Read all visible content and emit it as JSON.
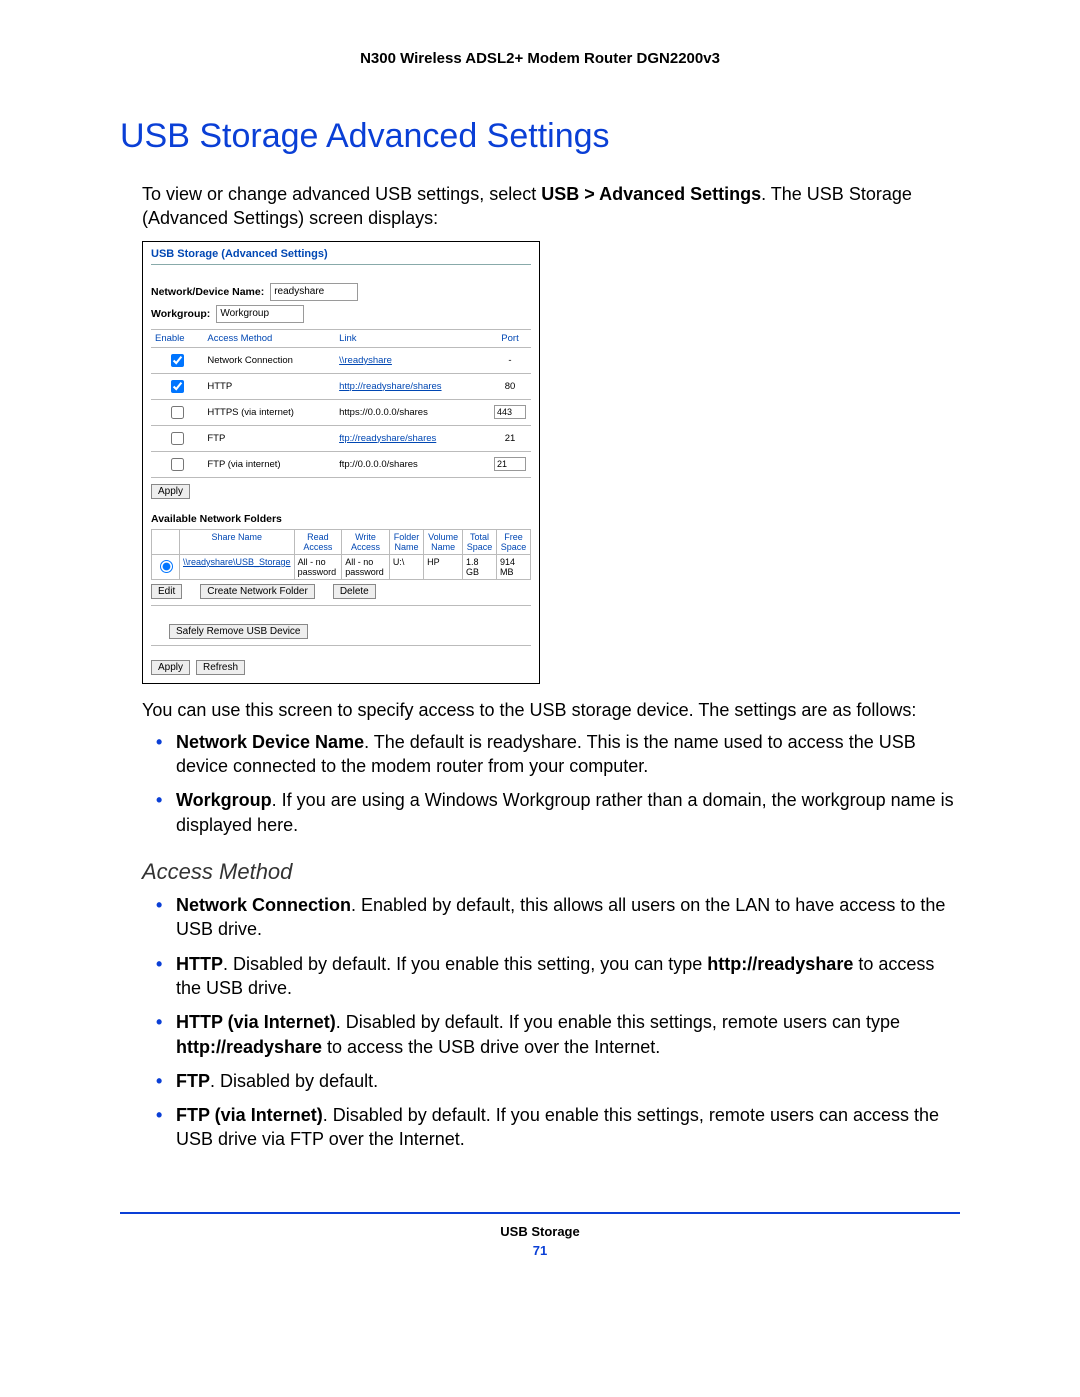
{
  "header": "N300 Wireless ADSL2+ Modem Router DGN2200v3",
  "section_title": "USB Storage Advanced Settings",
  "intro_pre": "To view or change advanced USB settings, select ",
  "intro_bold": "USB > Advanced Settings",
  "intro_post": ". The USB Storage (Advanced Settings) screen displays:",
  "panel": {
    "title": "USB Storage (Advanced Settings)",
    "device_label": "Network/Device Name:",
    "device_value": "readyshare",
    "workgroup_label": "Workgroup:",
    "workgroup_value": "Workgroup",
    "access": {
      "headers": {
        "enable": "Enable",
        "method": "Access Method",
        "link": "Link",
        "port": "Port"
      },
      "rows": [
        {
          "checked": true,
          "method": "Network Connection",
          "link": "\\\\readyshare",
          "is_link": true,
          "port": "-",
          "port_editable": false
        },
        {
          "checked": true,
          "method": "HTTP",
          "link": "http://readyshare/shares",
          "is_link": true,
          "port": "80",
          "port_editable": false
        },
        {
          "checked": false,
          "method": "HTTPS (via internet)",
          "link": "https://0.0.0.0/shares",
          "is_link": false,
          "port": "443",
          "port_editable": true
        },
        {
          "checked": false,
          "method": "FTP",
          "link": "ftp://readyshare/shares",
          "is_link": true,
          "port": "21",
          "port_editable": false
        },
        {
          "checked": false,
          "method": "FTP (via internet)",
          "link": "ftp://0.0.0.0/shares",
          "is_link": false,
          "port": "21",
          "port_editable": true
        }
      ]
    },
    "apply": "Apply",
    "folders_title": "Available Network Folders",
    "folders": {
      "headers": {
        "share": "Share Name",
        "read": "Read Access",
        "write": "Write Access",
        "folder": "Folder Name",
        "volume": "Volume Name",
        "total": "Total Space",
        "free": "Free Space"
      },
      "rows": [
        {
          "selected": true,
          "share": "\\\\readyshare\\USB_Storage",
          "read": "All - no password",
          "write": "All - no password",
          "folder": "U:\\",
          "volume": "HP",
          "total": "1.8 GB",
          "free": "914 MB"
        }
      ]
    },
    "buttons": {
      "edit": "Edit",
      "create": "Create Network Folder",
      "delete": "Delete",
      "safe": "Safely Remove USB Device",
      "apply2": "Apply",
      "refresh": "Refresh"
    }
  },
  "after_panel": "You can use this screen to specify access to the USB storage device. The settings are as follows:",
  "main_bullets": [
    {
      "bold": "Network Device Name",
      "text": ". The default is readyshare. This is the name used to access the USB device connected to the modem router from your computer."
    },
    {
      "bold": "Workgroup",
      "text": ". If you are using a Windows Workgroup rather than a domain, the workgroup name is displayed here."
    }
  ],
  "access_heading": "Access Method",
  "access_bullets": [
    {
      "bold": "Network Connection",
      "text_pre": ". Enabled by default, this allows all users on the LAN to have access to the USB drive."
    },
    {
      "bold": "HTTP",
      "text_pre": ". Disabled by default. If you enable this setting, you can type ",
      "bold2": "http://readyshare",
      "text_post": " to access the USB drive."
    },
    {
      "bold": "HTTP (via Internet)",
      "text_pre": ". Disabled by default. If you enable this settings, remote users can type ",
      "bold2": "http://readyshare",
      "text_post": " to access the USB drive over the Internet."
    },
    {
      "bold": "FTP",
      "text_pre": ". Disabled by default."
    },
    {
      "bold": "FTP (via Internet)",
      "text_pre": ". Disabled by default. If you enable this settings, remote users can access the USB drive via FTP over the Internet."
    }
  ],
  "footer_section": "USB Storage",
  "footer_page": "71"
}
